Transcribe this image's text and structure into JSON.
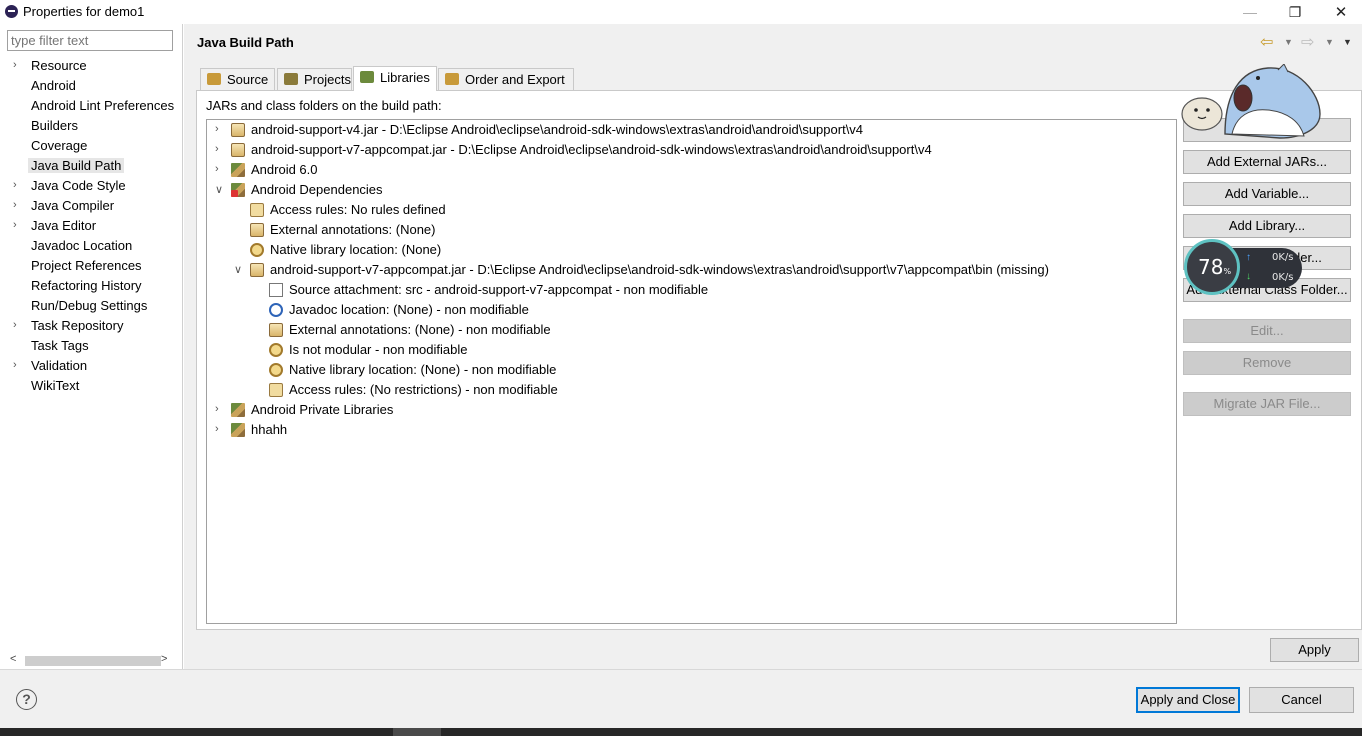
{
  "window": {
    "title": "Properties for demo1",
    "minimize_glyph": "—",
    "restore_glyph": "❐",
    "close_glyph": "✕"
  },
  "left": {
    "filter_placeholder": "type filter text",
    "items": [
      {
        "label": "Resource",
        "expandable": true
      },
      {
        "label": "Android",
        "expandable": false
      },
      {
        "label": "Android Lint Preferences",
        "expandable": false
      },
      {
        "label": "Builders",
        "expandable": false
      },
      {
        "label": "Coverage",
        "expandable": false
      },
      {
        "label": "Java Build Path",
        "expandable": false,
        "selected": true
      },
      {
        "label": "Java Code Style",
        "expandable": true
      },
      {
        "label": "Java Compiler",
        "expandable": true
      },
      {
        "label": "Java Editor",
        "expandable": true
      },
      {
        "label": "Javadoc Location",
        "expandable": false
      },
      {
        "label": "Project References",
        "expandable": false
      },
      {
        "label": "Refactoring History",
        "expandable": false
      },
      {
        "label": "Run/Debug Settings",
        "expandable": false
      },
      {
        "label": "Task Repository",
        "expandable": true
      },
      {
        "label": "Task Tags",
        "expandable": false
      },
      {
        "label": "Validation",
        "expandable": true
      },
      {
        "label": "WikiText",
        "expandable": false
      }
    ]
  },
  "main": {
    "page_title": "Java Build Path",
    "tabs": [
      {
        "label": "Source",
        "icon": "source-folder-icon"
      },
      {
        "label": "Projects",
        "icon": "projects-icon"
      },
      {
        "label": "Libraries",
        "icon": "libraries-icon",
        "active": true
      },
      {
        "label": "Order and Export",
        "icon": "order-export-icon"
      }
    ],
    "panel_label": "JARs and class folders on the build path:",
    "tree": [
      {
        "depth": 0,
        "chev": "›",
        "icon": "jar",
        "label": "android-support-v4.jar - D:\\Eclipse Android\\eclipse\\android-sdk-windows\\extras\\android\\android\\support\\v4"
      },
      {
        "depth": 0,
        "chev": "›",
        "icon": "jar",
        "label": "android-support-v7-appcompat.jar - D:\\Eclipse Android\\eclipse\\android-sdk-windows\\extras\\android\\android\\support\\v4"
      },
      {
        "depth": 0,
        "chev": "›",
        "icon": "lib",
        "label": "Android 6.0"
      },
      {
        "depth": 0,
        "chev": "⌄",
        "icon": "libx",
        "label": "Android Dependencies"
      },
      {
        "depth": 1,
        "chev": "",
        "icon": "rule",
        "label": "Access rules: No rules defined"
      },
      {
        "depth": 1,
        "chev": "",
        "icon": "jar",
        "label": "External annotations: (None)"
      },
      {
        "depth": 1,
        "chev": "",
        "icon": "mod",
        "label": "Native library location: (None)"
      },
      {
        "depth": 1,
        "chev": "⌄",
        "icon": "jar",
        "label": "android-support-v7-appcompat.jar - D:\\Eclipse Android\\eclipse\\android-sdk-windows\\extras\\android\\support\\v7\\appcompat\\bin (missing)"
      },
      {
        "depth": 2,
        "chev": "",
        "icon": "doc",
        "label": "Source attachment: src - android-support-v7-appcompat - non modifiable"
      },
      {
        "depth": 2,
        "chev": "",
        "icon": "at",
        "label": "Javadoc location: (None) - non modifiable"
      },
      {
        "depth": 2,
        "chev": "",
        "icon": "jar",
        "label": "External annotations: (None) - non modifiable"
      },
      {
        "depth": 2,
        "chev": "",
        "icon": "mod",
        "label": "Is not modular - non modifiable"
      },
      {
        "depth": 2,
        "chev": "",
        "icon": "mod",
        "label": "Native library location: (None) - non modifiable"
      },
      {
        "depth": 2,
        "chev": "",
        "icon": "rule",
        "label": "Access rules: (No restrictions) - non modifiable"
      },
      {
        "depth": 0,
        "chev": "›",
        "icon": "lib",
        "label": "Android Private Libraries"
      },
      {
        "depth": 0,
        "chev": "›",
        "icon": "lib",
        "label": "hhahh"
      }
    ],
    "side_buttons": [
      {
        "label": "",
        "disabled": false
      },
      {
        "label": "Add External JARs...",
        "disabled": false
      },
      {
        "label": "Add Variable...",
        "disabled": false
      },
      {
        "label": "Add Library...",
        "disabled": false
      },
      {
        "label": "Add Class Folder...",
        "disabled": false
      },
      {
        "label": "Add External Class Folder...",
        "disabled": false
      },
      {
        "label": "Edit...",
        "disabled": true
      },
      {
        "label": "Remove",
        "disabled": true
      },
      {
        "label": "Migrate JAR File...",
        "disabled": true
      }
    ],
    "apply_label": "Apply"
  },
  "footer": {
    "help_glyph": "?",
    "apply_close_label": "Apply and Close",
    "cancel_label": "Cancel"
  },
  "net_widget": {
    "percent": "78",
    "percent_unit": "%",
    "up_rate": "0K/s",
    "down_rate": "0K/s"
  }
}
